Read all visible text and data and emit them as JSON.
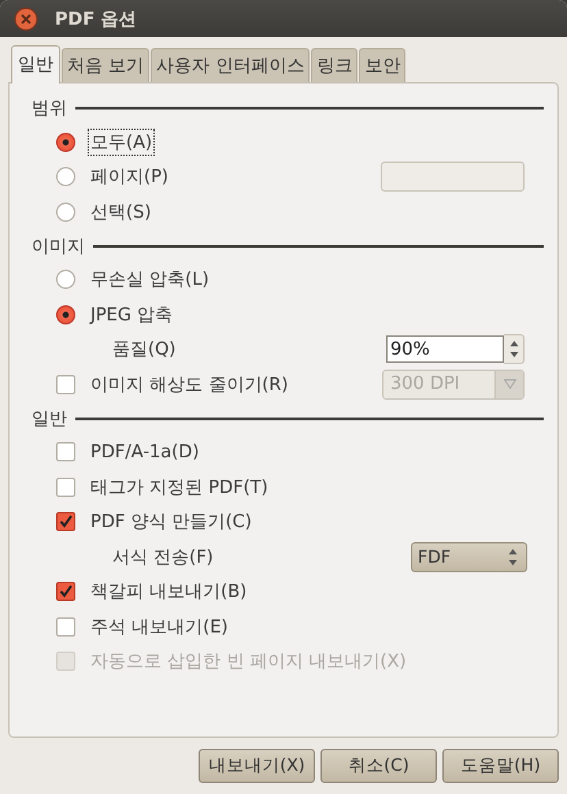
{
  "window": {
    "title": "PDF 옵션"
  },
  "tabs": [
    {
      "label": "일반",
      "selected": true
    },
    {
      "label": "처음 보기",
      "selected": false
    },
    {
      "label": "사용자 인터페이스",
      "selected": false
    },
    {
      "label": "링크",
      "selected": false
    },
    {
      "label": "보안",
      "selected": false
    }
  ],
  "sections": [
    {
      "title": "범위",
      "items": [
        {
          "kind": "radio",
          "label": "모두(A)",
          "selected": true,
          "focused": true
        },
        {
          "kind": "radio",
          "label": "페이지(P)",
          "selected": false,
          "input": {
            "kind": "text",
            "disabled": true
          }
        },
        {
          "kind": "radio",
          "label": "선택(S)",
          "selected": false
        }
      ]
    },
    {
      "title": "이미지",
      "items": [
        {
          "kind": "radio",
          "label": "무손실 압축(L)",
          "selected": false
        },
        {
          "kind": "radio",
          "label": "JPEG 압축",
          "selected": true
        },
        {
          "kind": "label",
          "label": "품질(Q)",
          "input": {
            "kind": "spin",
            "value": "90%",
            "disabled": false
          }
        },
        {
          "kind": "checkbox",
          "label": "이미지 해상도 줄이기(R)",
          "checked": false,
          "disabled": false,
          "input": {
            "kind": "combo",
            "value": "300 DPI",
            "disabled": true
          }
        }
      ]
    },
    {
      "title": "일반",
      "items": [
        {
          "kind": "checkbox",
          "label": "PDF/A-1a(D)",
          "checked": false,
          "disabled": false
        },
        {
          "kind": "checkbox",
          "label": "태그가 지정된 PDF(T)",
          "checked": false,
          "disabled": false
        },
        {
          "kind": "checkbox",
          "label": "PDF 양식 만들기(C)",
          "checked": true,
          "disabled": false
        },
        {
          "kind": "label",
          "label": "서식 전송(F)",
          "input": {
            "kind": "select",
            "value": "FDF",
            "disabled": false
          }
        },
        {
          "kind": "checkbox",
          "label": "책갈피 내보내기(B)",
          "checked": true,
          "disabled": false
        },
        {
          "kind": "checkbox",
          "label": "주석 내보내기(E)",
          "checked": false,
          "disabled": false
        },
        {
          "kind": "checkbox",
          "label": "자동으로 삽입한 빈 페이지 내보내기(X)",
          "checked": false,
          "disabled": true
        }
      ]
    }
  ],
  "buttons": [
    "내보내기(X)",
    "취소(C)",
    "도움말(H)"
  ]
}
